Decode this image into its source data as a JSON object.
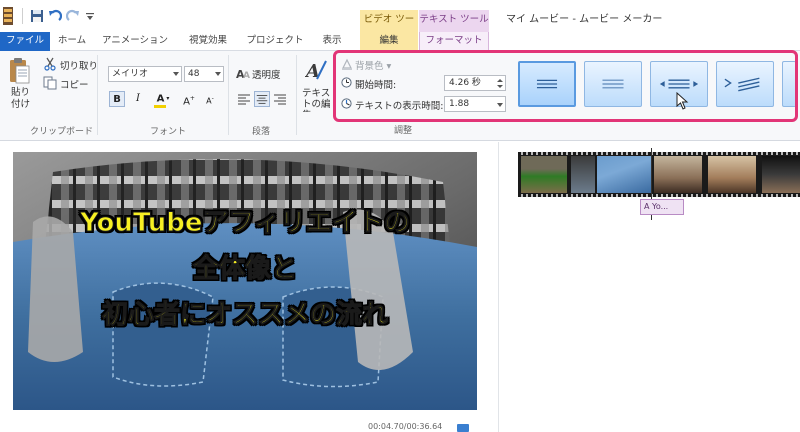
{
  "titlebar": {
    "window_title": "マイ ムービー - ムービー メーカー"
  },
  "contextual": {
    "video_tools": "ビデオ ツール",
    "text_tools": "テキスト ツール"
  },
  "tabs": {
    "file": "ファイル",
    "home": "ホーム",
    "animation": "アニメーション",
    "visual_effects": "視覚効果",
    "project": "プロジェクト",
    "view": "表示",
    "edit": "編集",
    "format": "フォーマット"
  },
  "clipboard": {
    "paste": "貼り付け",
    "cut": "切り取り",
    "copy": "コピー",
    "group_label": "クリップボード"
  },
  "font": {
    "name": "メイリオ",
    "size": "48",
    "group_label": "フォント"
  },
  "paragraph": {
    "transparency": "透明度",
    "group_label": "段落"
  },
  "edit_text": {
    "label": "テキストの編集"
  },
  "adjust": {
    "background_color": "背景色 ▾",
    "start_time_label": "開始時間:",
    "start_time_value": "4.26 秒",
    "text_duration_label": "テキストの表示時間:",
    "text_duration_value": "1.88",
    "group_label": "調整"
  },
  "preview": {
    "overlay_lines": [
      "YouTubeアフィリエイトの",
      "全体像と",
      "初心者にオススメの流れ"
    ],
    "time_readout": "00:04.70/00:36.64"
  },
  "storyboard": {
    "caption_chip": "A Yo..."
  },
  "colors": {
    "file_tab": "#1f67c6",
    "highlight_box": "#e23577",
    "video_tools": "#fbe7a3",
    "text_tools": "#ecd6ef",
    "overlay_text": "#f7f023"
  }
}
